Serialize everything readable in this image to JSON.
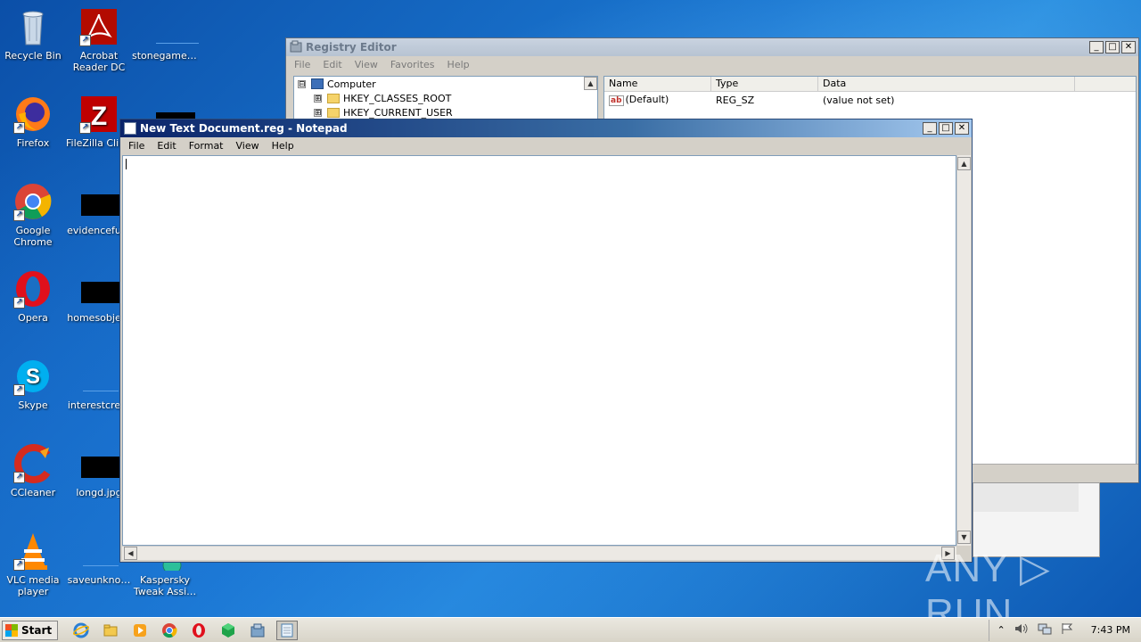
{
  "desktop": {
    "icons": [
      {
        "label": "Recycle Bin",
        "icon": "recycle-bin-icon"
      },
      {
        "label": "Acrobat Reader DC",
        "icon": "acrobat-icon"
      },
      {
        "label": "stonegame.…",
        "icon": "file-icon"
      },
      {
        "label": "Firefox",
        "icon": "firefox-icon"
      },
      {
        "label": "FileZilla Clie…",
        "icon": "filezilla-icon"
      },
      {
        "label": "Google Chrome",
        "icon": "chrome-icon"
      },
      {
        "label": "evidencefu…",
        "icon": "image-file-icon"
      },
      {
        "label": "Opera",
        "icon": "opera-icon"
      },
      {
        "label": "homesobje…",
        "icon": "image-file-icon"
      },
      {
        "label": "Skype",
        "icon": "skype-icon"
      },
      {
        "label": "interestcre…",
        "icon": "file-icon"
      },
      {
        "label": "CCleaner",
        "icon": "ccleaner-icon"
      },
      {
        "label": "longd.jpg",
        "icon": "image-file-icon"
      },
      {
        "label": "VLC media player",
        "icon": "vlc-icon"
      },
      {
        "label": "saveunkno…",
        "icon": "file-icon"
      },
      {
        "label": "Kaspersky Tweak Assi…",
        "icon": "kaspersky-icon"
      }
    ]
  },
  "regedit": {
    "title": "Registry Editor",
    "menu": [
      "File",
      "Edit",
      "View",
      "Favorites",
      "Help"
    ],
    "tree": {
      "root": "Computer",
      "root_expander": "⊟",
      "items": [
        {
          "label": "HKEY_CLASSES_ROOT",
          "expander": "⊞"
        },
        {
          "label": "HKEY_CURRENT_USER",
          "expander": "⊞"
        }
      ]
    },
    "columns": [
      "Name",
      "Type",
      "Data"
    ],
    "rows": [
      {
        "name": "(Default)",
        "type": "REG_SZ",
        "data": "(value not set)",
        "icon_text": "ab"
      }
    ]
  },
  "notepad": {
    "title": "New Text Document.reg - Notepad",
    "menu": [
      "File",
      "Edit",
      "Format",
      "View",
      "Help"
    ],
    "content": ""
  },
  "window_buttons": {
    "minimize": "_",
    "maximize": "□",
    "close": "✕"
  },
  "scroll": {
    "up": "▲",
    "down": "▼",
    "left": "◀",
    "right": "▶"
  },
  "watermark": "ANY ▷ RUN",
  "taskbar": {
    "start_label": "Start",
    "pinned": [
      {
        "icon": "internet-explorer-icon"
      },
      {
        "icon": "explorer-folder-icon"
      },
      {
        "icon": "media-player-icon"
      },
      {
        "icon": "chrome-icon"
      },
      {
        "icon": "opera-icon"
      },
      {
        "icon": "green-cube-icon"
      },
      {
        "icon": "regedit-icon"
      },
      {
        "icon": "notepad-icon",
        "active": true
      }
    ],
    "tray": {
      "chevron": "⌃",
      "time": "7:43 PM"
    }
  }
}
